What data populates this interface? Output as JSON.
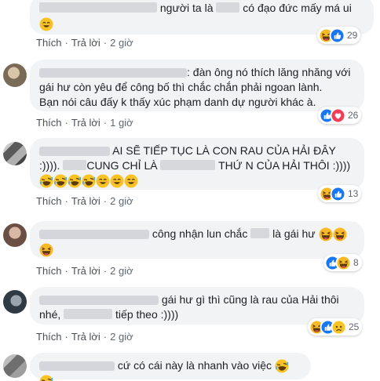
{
  "actions": {
    "like": "Thích",
    "reply": "Trả lời",
    "sep": "·"
  },
  "comments": [
    {
      "text_before": "người ta là",
      "text_after": "có đạo đức mấy má ui",
      "time": "2 giờ",
      "reaction_count": "29",
      "reactions": [
        "haha-icon",
        "like-icon"
      ]
    },
    {
      "line1": ": đàn ông nó thích lăng nhăng với",
      "line2": "gái hư còn yêu để công bố thì chắc chắn phải ngoan lành.",
      "line3": "Bạn nói câu đấy k thấy xúc phạm danh dự người khác à.",
      "time": "1 giờ",
      "reaction_count": "26",
      "reactions": [
        "like-icon",
        "love-icon"
      ]
    },
    {
      "line1a": "AI SẼ TIẾP TỤC LÀ CON RAU CỦA HẢI ĐÂY",
      "line2a": ":)))).",
      "line2b": "CUNG CHỈ LÀ",
      "line2c": "THỨ N CỦA HẢI THÔI :))))",
      "time": "2 giờ",
      "reaction_count": "13",
      "reactions": [
        "haha-icon",
        "like-icon"
      ]
    },
    {
      "text_before": "công nhận lun chắc",
      "text_after": "là gái hư",
      "time": "2 giờ",
      "reaction_count": "8",
      "reactions": [
        "like-icon",
        "haha-icon"
      ]
    },
    {
      "line1": "gái hư gì thì cũng là rau của Hải thôi",
      "line2a": "nhé,",
      "line2b": "tiếp theo :))))",
      "time": "2 giờ",
      "reaction_count": "25",
      "reactions": [
        "haha-icon",
        "like-icon",
        "sad-icon"
      ]
    },
    {
      "text": "cứ có cái này là nhanh vào việc"
    }
  ],
  "colors": {
    "like": "#1877f2",
    "love": "#f33e58",
    "haha": "#f7b125",
    "bubble": "#f2f3f5",
    "meta": "#606770"
  }
}
